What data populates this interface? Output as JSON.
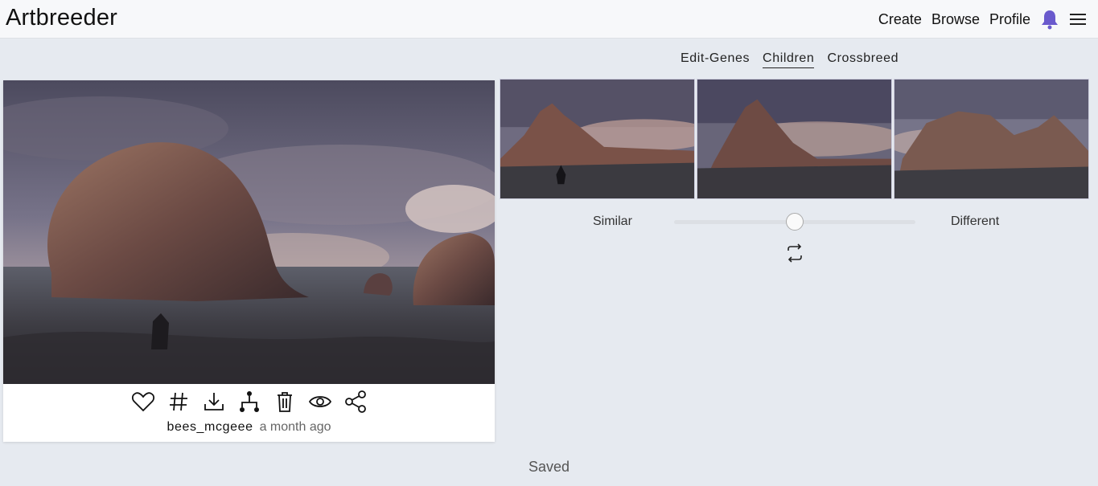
{
  "app": {
    "logo": "Artbreeder"
  },
  "nav": {
    "create": "Create",
    "browse": "Browse",
    "profile": "Profile",
    "bell_icon": "bell-icon",
    "menu_icon": "hamburger-menu-icon"
  },
  "colors": {
    "bell": "#6a5acd",
    "background": "#e6eaf0"
  },
  "tabs": [
    {
      "label": "Edit-Genes",
      "active": false
    },
    {
      "label": "Children",
      "active": true
    },
    {
      "label": "Crossbreed",
      "active": false
    }
  ],
  "image_card": {
    "actions": [
      "heart-icon",
      "hashtag-icon",
      "download-icon",
      "family-tree-icon",
      "trash-icon",
      "eye-icon",
      "share-icon"
    ],
    "username": "bees_mcgeee",
    "time": "a month ago"
  },
  "children": {
    "count": 3
  },
  "slider": {
    "left_label": "Similar",
    "right_label": "Different",
    "value": 0.5
  },
  "status": {
    "text": "Saved"
  }
}
